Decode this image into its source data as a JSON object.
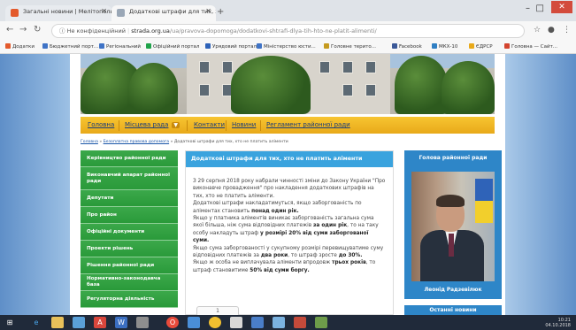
{
  "browser": {
    "tabs": [
      {
        "title": "Загальні новини | Мелітопольський...",
        "active": false
      },
      {
        "title": "Додаткові штрафи для тих, хто ...",
        "active": true
      }
    ],
    "address": {
      "security_label": "Не конфіденційний",
      "host": "strada.org.ua",
      "path": "/ua/pravova-dopomoga/dodatkovi-shtrafi-dlya-tih-hto-ne-platit-alimenti/"
    },
    "bookmarks": [
      {
        "label": "Додатки",
        "color": "#e35a2c"
      },
      {
        "label": "Бюджетний порт...",
        "color": "#3f73c6"
      },
      {
        "label": "Регіональний",
        "color": "#3f73c6"
      },
      {
        "label": "Офіційний портал",
        "color": "#1fa34a"
      },
      {
        "label": "Урядовий портал",
        "color": "#2d62b8"
      },
      {
        "label": "Міністерство юсти...",
        "color": "#3f73c6"
      },
      {
        "label": "Головне терито...",
        "color": "#c59a1e"
      },
      {
        "label": "Facebook",
        "color": "#3b5998"
      },
      {
        "label": "МКХ-10",
        "color": "#2f7fc3"
      },
      {
        "label": "ЄДРСР",
        "color": "#e8a91a"
      },
      {
        "label": "Головна — Сайт...",
        "color": "#d3442e"
      }
    ]
  },
  "site": {
    "menu": [
      "Головна",
      "Місцева рада",
      "Контакти",
      "Новини",
      "Регламент районної ради"
    ],
    "breadcrumb": {
      "items": [
        "Головна",
        "Безоплатна правова допомога"
      ],
      "current": "Додаткові штрафи для тих, хто не платить аліменти"
    },
    "sidebar": [
      "Керівництво районної ради",
      "Виконавчий апарат районної ради",
      "Депутати",
      "Про район",
      "Офіційні документи",
      "Проекти рішень",
      "Рішення районної ради",
      "Нормативно-законодавча база",
      "Регуляторна діяльність"
    ],
    "article": {
      "title": "Додаткові штрафи для тих, хто не платить аліменти",
      "paragraphs": [
        [
          {
            "t": "З 29 серпня 2018 року набрали чинності зміни до Закону України \"Про виконавче провадження\" про накладення додаткових штрафів на тих, хто не платить аліменти."
          }
        ],
        [
          {
            "t": "Додаткові штрафи накладатимуться, якщо заборгованість по аліментах становить "
          },
          {
            "t": "понад один рік.",
            "b": true
          }
        ],
        [
          {
            "t": "Якщо у платника аліментів виникає заборгованість загальна сума якої більша, ніж сума відповідних платежів "
          },
          {
            "t": "за один рік",
            "b": true
          },
          {
            "t": ", то на таку особу накладуть штраф "
          },
          {
            "t": "у розмірі 20% від суми заборгованої суми.",
            "b": true
          }
        ],
        [
          {
            "t": "Якщо сума заборгованості у сукупному розмірі перевищуватиме суму відповідних платежів за "
          },
          {
            "t": "два роки",
            "b": true
          },
          {
            "t": ", то штраф зросте "
          },
          {
            "t": "до 30%.",
            "b": true
          }
        ],
        [
          {
            "t": "Якщо ж особа не виплачувала аліменти впродовж "
          },
          {
            "t": "трьох років",
            "b": true
          },
          {
            "t": ", то штраф становитиме "
          },
          {
            "t": "50% від суми боргу.",
            "b": true
          }
        ]
      ],
      "like_label": "1"
    },
    "right_panel": {
      "title": "Голова районної ради",
      "person_name": "Леонід Радзевілюк",
      "next_title": "Останні новини"
    }
  },
  "taskbar": {
    "time": "10:21",
    "date": "04.10.2018"
  }
}
